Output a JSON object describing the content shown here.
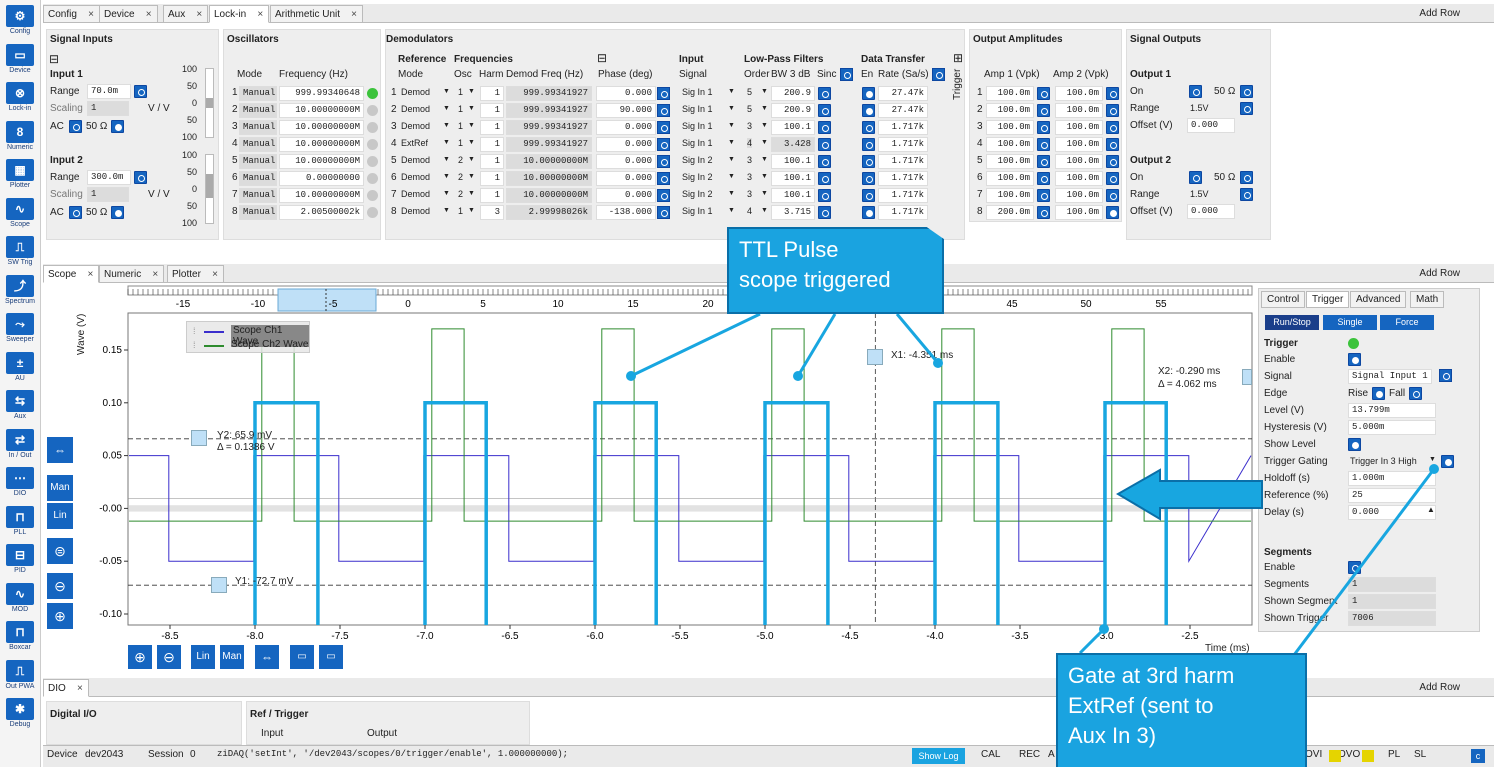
{
  "toolbar": [
    "Config",
    "Device",
    "Lock-in",
    "Numeric",
    "Plotter",
    "Scope",
    "SW Trig",
    "Spectrum",
    "Sweeper",
    "AU",
    "Aux",
    "In / Out",
    "DIO",
    "PLL",
    "PID",
    "MOD",
    "Boxcar",
    "Out PWA",
    "Debug"
  ],
  "top_tabs": [
    "Config",
    "Device",
    "Aux",
    "Lock-in",
    "Arithmetic Unit"
  ],
  "add_row": "Add Row",
  "signal_inputs": {
    "title": "Signal Inputs",
    "input1": {
      "label": "Input 1",
      "range_label": "Range",
      "range": "70.0m",
      "scaling_label": "Scaling",
      "scaling": "1",
      "unit": "V / V",
      "ac_label": "AC",
      "ohm": "50 Ω"
    },
    "input2": {
      "label": "Input 2",
      "range_label": "Range",
      "range": "300.0m",
      "scaling_label": "Scaling",
      "scaling": "1",
      "unit": "V / V",
      "ac_label": "AC",
      "ohm": "50 Ω"
    },
    "bar1": [
      "100",
      "50",
      "0",
      "50",
      "100"
    ],
    "bar2": [
      "100",
      "50",
      "0",
      "50",
      "100"
    ]
  },
  "oscillators": {
    "title": "Oscillators",
    "headers": [
      "Mode",
      "Frequency (Hz)"
    ],
    "rows": [
      {
        "n": "1",
        "mode": "Manual",
        "freq": "999.99340648"
      },
      {
        "n": "2",
        "mode": "Manual",
        "freq": "10.00000000M"
      },
      {
        "n": "3",
        "mode": "Manual",
        "freq": "10.00000000M"
      },
      {
        "n": "4",
        "mode": "Manual",
        "freq": "10.00000000M"
      },
      {
        "n": "5",
        "mode": "Manual",
        "freq": "10.00000000M"
      },
      {
        "n": "6",
        "mode": "Manual",
        "freq": "0.00000000"
      },
      {
        "n": "7",
        "mode": "Manual",
        "freq": "10.00000000M"
      },
      {
        "n": "8",
        "mode": "Manual",
        "freq": "2.00500002k"
      }
    ]
  },
  "demodulators": {
    "title": "Demodulators",
    "sub_reference": "Reference",
    "sub_frequencies": "Frequencies",
    "sub_input": "Input",
    "sub_lpf": "Low-Pass Filters",
    "sub_dt": "Data Transfer",
    "headers": [
      "Mode",
      "Osc",
      "Harm",
      "Demod Freq (Hz)",
      "Phase (deg)",
      "Signal",
      "Order",
      "BW 3 dB",
      "Sinc",
      "En",
      "Rate (Sa/s)"
    ],
    "trigger_label": "Trigger",
    "rows": [
      {
        "n": "1",
        "mode": "Demod",
        "osc": "1",
        "harm": "1",
        "freq": "999.99341927",
        "phase": "0.000",
        "signal": "Sig In 1",
        "order": "5",
        "bw": "200.9",
        "rate": "27.47k"
      },
      {
        "n": "2",
        "mode": "Demod",
        "osc": "1",
        "harm": "1",
        "freq": "999.99341927",
        "phase": "90.000",
        "signal": "Sig In 1",
        "order": "5",
        "bw": "200.9",
        "rate": "27.47k"
      },
      {
        "n": "3",
        "mode": "Demod",
        "osc": "1",
        "harm": "1",
        "freq": "999.99341927",
        "phase": "0.000",
        "signal": "Sig In 1",
        "order": "3",
        "bw": "100.1",
        "rate": "1.717k"
      },
      {
        "n": "4",
        "mode": "ExtRef",
        "osc": "1",
        "harm": "1",
        "freq": "999.99341927",
        "phase": "0.000",
        "signal": "Sig In 1",
        "order": "4",
        "bw": "3.428",
        "rate": "1.717k"
      },
      {
        "n": "5",
        "mode": "Demod",
        "osc": "2",
        "harm": "1",
        "freq": "10.00000000M",
        "phase": "0.000",
        "signal": "Sig In 2",
        "order": "3",
        "bw": "100.1",
        "rate": "1.717k"
      },
      {
        "n": "6",
        "mode": "Demod",
        "osc": "2",
        "harm": "1",
        "freq": "10.00000000M",
        "phase": "0.000",
        "signal": "Sig In 2",
        "order": "3",
        "bw": "100.1",
        "rate": "1.717k"
      },
      {
        "n": "7",
        "mode": "Demod",
        "osc": "2",
        "harm": "1",
        "freq": "10.00000000M",
        "phase": "0.000",
        "signal": "Sig In 2",
        "order": "3",
        "bw": "100.1",
        "rate": "1.717k"
      },
      {
        "n": "8",
        "mode": "Demod",
        "osc": "1",
        "harm": "3",
        "freq": "2.99998026k",
        "phase": "-138.000",
        "signal": "Sig In 1",
        "order": "4",
        "bw": "3.715",
        "rate": "1.717k"
      }
    ]
  },
  "output_amplitudes": {
    "title": "Output Amplitudes",
    "headers": [
      "Amp 1 (Vpk)",
      "Amp 2 (Vpk)"
    ],
    "rows": [
      {
        "n": "1",
        "a1": "100.0m",
        "a2": "100.0m"
      },
      {
        "n": "2",
        "a1": "100.0m",
        "a2": "100.0m"
      },
      {
        "n": "3",
        "a1": "100.0m",
        "a2": "100.0m"
      },
      {
        "n": "4",
        "a1": "100.0m",
        "a2": "100.0m"
      },
      {
        "n": "5",
        "a1": "100.0m",
        "a2": "100.0m"
      },
      {
        "n": "6",
        "a1": "100.0m",
        "a2": "100.0m"
      },
      {
        "n": "7",
        "a1": "100.0m",
        "a2": "100.0m"
      },
      {
        "n": "8",
        "a1": "200.0m",
        "a2": "100.0m"
      }
    ]
  },
  "signal_outputs": {
    "title": "Signal Outputs",
    "out1": {
      "label": "Output 1",
      "on": "On",
      "ohm": "50 Ω",
      "range_label": "Range",
      "range": "1.5V",
      "offset_label": "Offset (V)",
      "offset": "0.000"
    },
    "out2": {
      "label": "Output 2",
      "on": "On",
      "ohm": "50 Ω",
      "range_label": "Range",
      "range": "1.5V",
      "offset_label": "Offset (V)",
      "offset": "0.000"
    }
  },
  "mid_tabs": [
    "Scope",
    "Numeric",
    "Plotter"
  ],
  "scope": {
    "ylabel": "Wave (V)",
    "xlabel": "Time (ms)",
    "legend": [
      "Scope Ch1 Wave",
      "Scope Ch2 Wave"
    ],
    "yticks": [
      "0.15",
      "0.10",
      "0.05",
      "-0.00",
      "-0.05",
      "-0.10"
    ],
    "xticks": [
      "-8.5",
      "-8.0",
      "-7.5",
      "-7.0",
      "-6.5",
      "-6.0",
      "-5.5",
      "-5.0",
      "-4.5",
      "-4.0",
      "-3.5",
      "-3.0",
      "-2.5"
    ],
    "top_ticks": [
      "-15",
      "-10",
      "-5",
      "0",
      "5",
      "10",
      "15",
      "20",
      "45",
      "50",
      "55"
    ],
    "cursor_x1": "X1: -4.351 ms",
    "cursor_x2": "X2: -0.290 ms",
    "cursor_dx": "Δ = 4.062 ms",
    "cursor_y2": "Y2: 65.9 mV",
    "cursor_dy": "Δ = 0.1386 V",
    "cursor_y1": "Y1: -72.7 mV",
    "side_btns": [
      "Man",
      "Lin"
    ],
    "bottom_btns": [
      "Lin",
      "Man"
    ],
    "colors": {
      "ch1": "#3a2ecc",
      "ch2": "#2e8b2e",
      "highlight": "#18a6e0"
    }
  },
  "trigger_panel": {
    "tabs": [
      "Control",
      "Trigger",
      "Advanced",
      "Math"
    ],
    "buttons": [
      "Run/Stop",
      "Single",
      "Force"
    ],
    "trigger_title": "Trigger",
    "enable": "Enable",
    "signal_label": "Signal",
    "signal": "Signal Input 1",
    "edge_label": "Edge",
    "rise": "Rise",
    "fall": "Fall",
    "level_label": "Level (V)",
    "level": "13.799m",
    "hyst_label": "Hysteresis (V)",
    "hyst": "5.000m",
    "show_level": "Show Level",
    "gating_label": "Trigger Gating",
    "gating": "Trigger In 3 High",
    "holdoff_label": "Holdoff (s)",
    "holdoff": "1.000m",
    "ref_label": "Reference (%)",
    "ref": "25",
    "delay_label": "Delay (s)",
    "delay": "0.000",
    "segments_title": "Segments",
    "seg_enable": "Enable",
    "segments_label": "Segments",
    "segments": "1",
    "shown_seg_label": "Shown Segment",
    "shown_seg": "1",
    "shown_trig_label": "Shown Trigger",
    "shown_trig": "7006"
  },
  "bottom_tabs": [
    "DIO"
  ],
  "dio": {
    "digital_io": "Digital I/O",
    "ref_trigger": "Ref / Trigger",
    "input": "Input",
    "output": "Output"
  },
  "status": {
    "device_label": "Device",
    "device": "dev2043",
    "session_label": "Session",
    "session": "0",
    "cmd": "ziDAQ('setInt', '/dev2043/scopes/0/trigger/enable',    1.000000000);",
    "show_log": "Show Log",
    "flags": [
      "CAL",
      "REC",
      "A",
      "OVI",
      "OVO",
      "PL",
      "SL"
    ]
  },
  "callouts": {
    "ttl": [
      "TTL  Pulse",
      "scope triggered"
    ],
    "gate": [
      "Gate at 3rd harm",
      "ExtRef (sent to",
      "Aux In 3)"
    ]
  }
}
